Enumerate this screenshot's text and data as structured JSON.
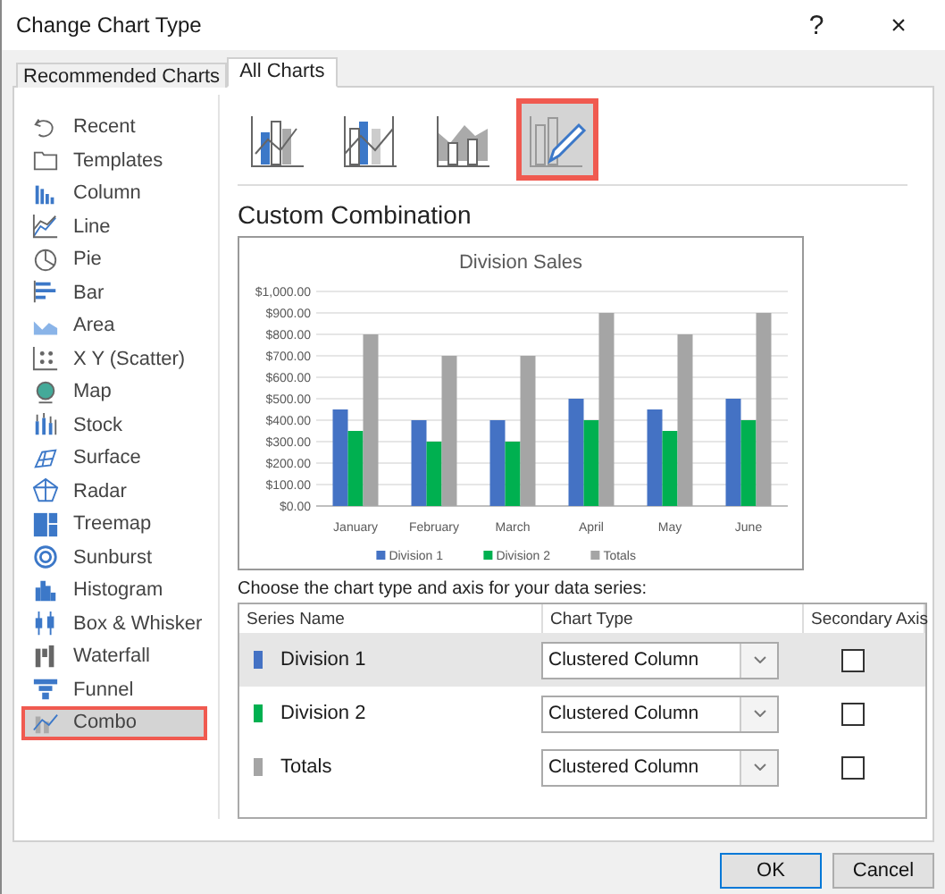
{
  "window": {
    "title": "Change Chart Type",
    "help": "?",
    "close": "×"
  },
  "tabs": [
    {
      "label": "Recommended Charts",
      "selected": false
    },
    {
      "label": "All Charts",
      "selected": true
    }
  ],
  "sidebar": {
    "items": [
      {
        "label": "Recent",
        "selected": false
      },
      {
        "label": "Templates",
        "selected": false
      },
      {
        "label": "Column",
        "selected": false
      },
      {
        "label": "Line",
        "selected": false
      },
      {
        "label": "Pie",
        "selected": false
      },
      {
        "label": "Bar",
        "selected": false
      },
      {
        "label": "Area",
        "selected": false
      },
      {
        "label": "X Y (Scatter)",
        "selected": false
      },
      {
        "label": "Map",
        "selected": false
      },
      {
        "label": "Stock",
        "selected": false
      },
      {
        "label": "Surface",
        "selected": false
      },
      {
        "label": "Radar",
        "selected": false
      },
      {
        "label": "Treemap",
        "selected": false
      },
      {
        "label": "Sunburst",
        "selected": false
      },
      {
        "label": "Histogram",
        "selected": false
      },
      {
        "label": "Box & Whisker",
        "selected": false
      },
      {
        "label": "Waterfall",
        "selected": false
      },
      {
        "label": "Funnel",
        "selected": false
      },
      {
        "label": "Combo",
        "selected": true
      }
    ]
  },
  "subtypes": [
    {
      "selected": false
    },
    {
      "selected": false
    },
    {
      "selected": false
    },
    {
      "selected": true
    }
  ],
  "heading": "Custom Combination",
  "chart": {
    "chart_data": {
      "type": "bar",
      "title": "Division Sales",
      "categories": [
        "January",
        "February",
        "March",
        "April",
        "May",
        "June"
      ],
      "series": [
        {
          "name": "Division 1",
          "color": "#4472c4",
          "values": [
            450,
            400,
            400,
            500,
            450,
            500
          ]
        },
        {
          "name": "Division 2",
          "color": "#00b050",
          "values": [
            350,
            300,
            300,
            400,
            350,
            400
          ]
        },
        {
          "name": "Totals",
          "color": "#a5a5a5",
          "values": [
            800,
            700,
            700,
            900,
            800,
            900
          ]
        }
      ],
      "ylim": [
        0,
        1000
      ],
      "grid": true,
      "legend": true,
      "yticks": [
        {
          "value": 0,
          "label": "$0.00"
        },
        {
          "value": 100,
          "label": "$100.00"
        },
        {
          "value": 200,
          "label": "$200.00"
        },
        {
          "value": 300,
          "label": "$300.00"
        },
        {
          "value": 400,
          "label": "$400.00"
        },
        {
          "value": 500,
          "label": "$500.00"
        },
        {
          "value": 600,
          "label": "$600.00"
        },
        {
          "value": 700,
          "label": "$700.00"
        },
        {
          "value": 800,
          "label": "$800.00"
        },
        {
          "value": 900,
          "label": "$900.00"
        },
        {
          "value": 1000,
          "label": "$1,000.00"
        }
      ]
    }
  },
  "series_prompt": "Choose the chart type and axis for your data series:",
  "series_table": {
    "columns": [
      "Series Name",
      "Chart Type",
      "Secondary Axis"
    ],
    "rows": [
      {
        "name": "Division 1",
        "color": "#4472c4",
        "chart_type": "Clustered Column",
        "secondary_axis": false,
        "selected": true
      },
      {
        "name": "Division 2",
        "color": "#00b050",
        "chart_type": "Clustered Column",
        "secondary_axis": false,
        "selected": false
      },
      {
        "name": "Totals",
        "color": "#a5a5a5",
        "chart_type": "Clustered Column",
        "secondary_axis": false,
        "selected": false
      }
    ]
  },
  "buttons": [
    {
      "label": "OK",
      "default": true
    },
    {
      "label": "Cancel",
      "default": false
    }
  ]
}
